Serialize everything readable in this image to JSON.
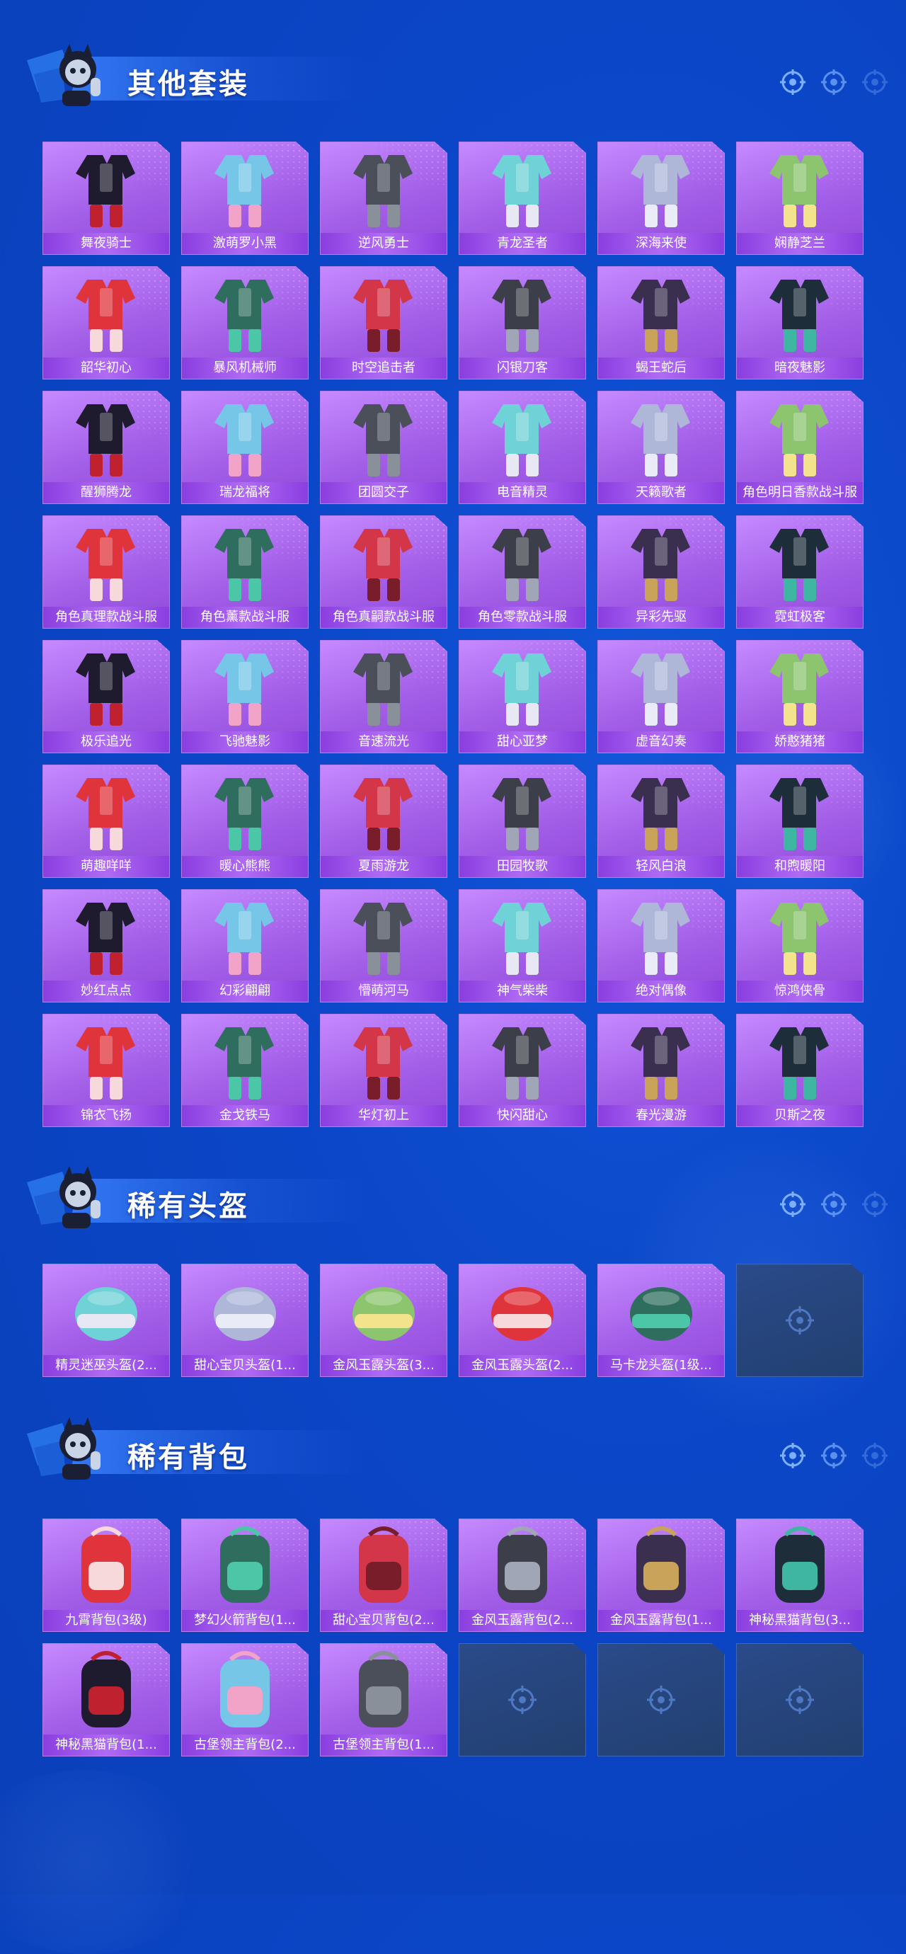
{
  "sections": [
    {
      "title": "其他套装",
      "items": [
        {
          "label": "舞夜骑士",
          "icon": "outfit-icon"
        },
        {
          "label": "激萌罗小黑",
          "icon": "outfit-icon"
        },
        {
          "label": "逆风勇士",
          "icon": "outfit-icon"
        },
        {
          "label": "青龙圣者",
          "icon": "outfit-icon"
        },
        {
          "label": "深海来使",
          "icon": "outfit-icon"
        },
        {
          "label": "娴静芝兰",
          "icon": "outfit-icon"
        },
        {
          "label": "韶华初心",
          "icon": "outfit-icon"
        },
        {
          "label": "暴风机械师",
          "icon": "outfit-icon"
        },
        {
          "label": "时空追击者",
          "icon": "outfit-icon"
        },
        {
          "label": "闪银刀客",
          "icon": "outfit-icon"
        },
        {
          "label": "蝎王蛇后",
          "icon": "outfit-icon"
        },
        {
          "label": "暗夜魅影",
          "icon": "outfit-icon"
        },
        {
          "label": "醒狮腾龙",
          "icon": "outfit-icon"
        },
        {
          "label": "瑞龙福将",
          "icon": "outfit-icon"
        },
        {
          "label": "团圆交子",
          "icon": "outfit-icon"
        },
        {
          "label": "电音精灵",
          "icon": "outfit-icon"
        },
        {
          "label": "天籁歌者",
          "icon": "outfit-icon"
        },
        {
          "label": "角色明日香款战斗服",
          "icon": "outfit-icon"
        },
        {
          "label": "角色真理款战斗服",
          "icon": "outfit-icon"
        },
        {
          "label": "角色薰款战斗服",
          "icon": "outfit-icon"
        },
        {
          "label": "角色真嗣款战斗服",
          "icon": "outfit-icon"
        },
        {
          "label": "角色零款战斗服",
          "icon": "outfit-icon"
        },
        {
          "label": "异彩先驱",
          "icon": "outfit-icon"
        },
        {
          "label": "霓虹极客",
          "icon": "outfit-icon"
        },
        {
          "label": "极乐追光",
          "icon": "outfit-icon"
        },
        {
          "label": "飞驰魅影",
          "icon": "outfit-icon"
        },
        {
          "label": "音速流光",
          "icon": "outfit-icon"
        },
        {
          "label": "甜心亚梦",
          "icon": "outfit-icon"
        },
        {
          "label": "虚音幻奏",
          "icon": "outfit-icon"
        },
        {
          "label": "娇憨猪猪",
          "icon": "outfit-icon"
        },
        {
          "label": "萌趣咩咩",
          "icon": "outfit-icon"
        },
        {
          "label": "暖心熊熊",
          "icon": "outfit-icon"
        },
        {
          "label": "夏雨游龙",
          "icon": "outfit-icon"
        },
        {
          "label": "田园牧歌",
          "icon": "outfit-icon"
        },
        {
          "label": "轻风白浪",
          "icon": "outfit-icon"
        },
        {
          "label": "和煦暖阳",
          "icon": "outfit-icon"
        },
        {
          "label": "妙红点点",
          "icon": "outfit-icon"
        },
        {
          "label": "幻彩翩翩",
          "icon": "outfit-icon"
        },
        {
          "label": "懵萌河马",
          "icon": "outfit-icon"
        },
        {
          "label": "神气柴柴",
          "icon": "outfit-icon"
        },
        {
          "label": "绝对偶像",
          "icon": "outfit-icon"
        },
        {
          "label": "惊鸿侠骨",
          "icon": "outfit-icon"
        },
        {
          "label": "锦衣飞扬",
          "icon": "outfit-icon"
        },
        {
          "label": "金戈铁马",
          "icon": "outfit-icon"
        },
        {
          "label": "华灯初上",
          "icon": "outfit-icon"
        },
        {
          "label": "快闪甜心",
          "icon": "outfit-icon"
        },
        {
          "label": "春光漫游",
          "icon": "outfit-icon"
        },
        {
          "label": "贝斯之夜",
          "icon": "outfit-icon"
        }
      ]
    },
    {
      "title": "稀有头盔",
      "items": [
        {
          "label": "精灵迷巫头盔(2...",
          "icon": "helmet-icon"
        },
        {
          "label": "甜心宝贝头盔(1...",
          "icon": "helmet-icon"
        },
        {
          "label": "金风玉露头盔(3...",
          "icon": "helmet-icon"
        },
        {
          "label": "金风玉露头盔(2...",
          "icon": "helmet-icon"
        },
        {
          "label": "马卡龙头盔(1级...",
          "icon": "helmet-icon"
        },
        {
          "label": "",
          "icon": "empty-slot-icon",
          "empty": true
        }
      ]
    },
    {
      "title": "稀有背包",
      "items": [
        {
          "label": "九霄背包(3级)",
          "icon": "backpack-icon"
        },
        {
          "label": "梦幻火箭背包(1...",
          "icon": "backpack-icon"
        },
        {
          "label": "甜心宝贝背包(2...",
          "icon": "backpack-icon"
        },
        {
          "label": "金风玉露背包(2...",
          "icon": "backpack-icon"
        },
        {
          "label": "金风玉露背包(1...",
          "icon": "backpack-icon"
        },
        {
          "label": "神秘黑猫背包(3...",
          "icon": "backpack-icon"
        },
        {
          "label": "神秘黑猫背包(1...",
          "icon": "backpack-icon"
        },
        {
          "label": "古堡领主背包(2...",
          "icon": "backpack-icon"
        },
        {
          "label": "古堡领主背包(1...",
          "icon": "backpack-icon"
        },
        {
          "label": "",
          "icon": "empty-slot-icon",
          "empty": true
        },
        {
          "label": "",
          "icon": "empty-slot-icon",
          "empty": true
        },
        {
          "label": "",
          "icon": "empty-slot-icon",
          "empty": true
        }
      ]
    }
  ],
  "colors": {
    "background": "#0b47c9",
    "card": "#a35fe8",
    "label_bar": "#8a3ee0",
    "empty_card": "#22406f"
  }
}
